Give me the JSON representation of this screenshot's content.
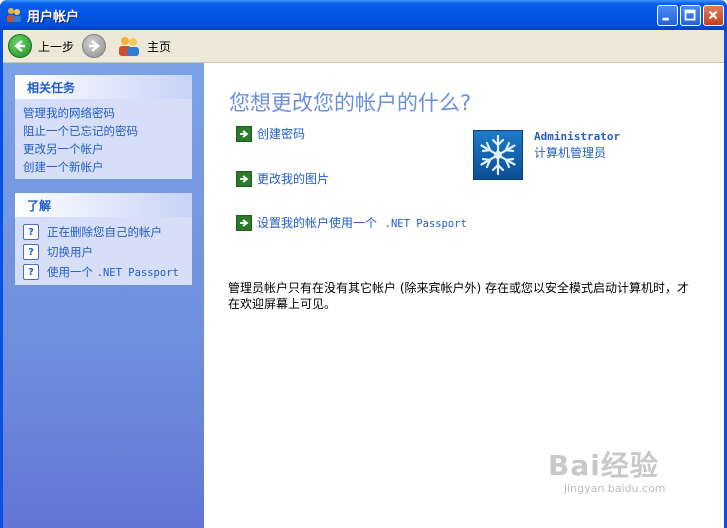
{
  "window": {
    "title": "用户帐户"
  },
  "toolbar": {
    "back_label": "上一步",
    "home_label": "主页"
  },
  "sidebar": {
    "tasks_title": "相关任务",
    "tasks": [
      "管理我的网络密码",
      "阻止一个已忘记的密码",
      "更改另一个帐户",
      "创建一个新帐户"
    ],
    "learn_title": "了解",
    "learn": [
      "正在删除您自己的帐户",
      "切换用户"
    ],
    "learn_passport_prefix": "使用一个",
    "learn_passport_suffix": ".NET Passport"
  },
  "main": {
    "heading": "您想更改您的帐户的什么?",
    "actions": [
      "创建密码",
      "更改我的图片"
    ],
    "action_passport_prefix": "设置我的帐户使用一个",
    "action_passport_suffix": ".NET Passport",
    "user_name": "Administrator",
    "user_role": "计算机管理员",
    "note": "管理员帐户只有在没有其它帐户 (除来宾帐户外) 存在或您以安全模式启动计算机时，才在欢迎屏幕上可见。"
  },
  "watermark": {
    "brand": "Bai经验",
    "url": "jingyan.baidu.com"
  },
  "colors": {
    "titlebar": "#0058e6",
    "link": "#215dc6",
    "heading": "#6c8fd9",
    "sidebar": "#7ba2e7"
  }
}
